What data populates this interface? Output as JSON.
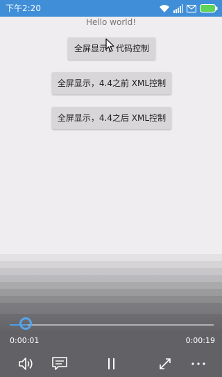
{
  "statusbar": {
    "time": "下午2:20",
    "icons": [
      "wifi-icon",
      "signal-icon",
      "mail-icon",
      "battery-icon"
    ]
  },
  "main": {
    "hello_text": "Hello world!",
    "buttons": [
      {
        "label": "全屏显示，代码控制"
      },
      {
        "label": "全屏显示，4.4之前 XML控制"
      },
      {
        "label": "全屏显示，4.4之后 XML控制"
      }
    ]
  },
  "player": {
    "current_time": "0:00:01",
    "total_time": "0:00:19",
    "progress": 0.05,
    "controls": [
      "volume-icon",
      "subtitle-icon",
      "pause-icon",
      "fullscreen-icon",
      "more-icon"
    ]
  },
  "colors": {
    "status_bar": "#3f8ed7",
    "background": "#efedf0",
    "accent": "#4d9de6",
    "button": "#d8d6d9"
  }
}
